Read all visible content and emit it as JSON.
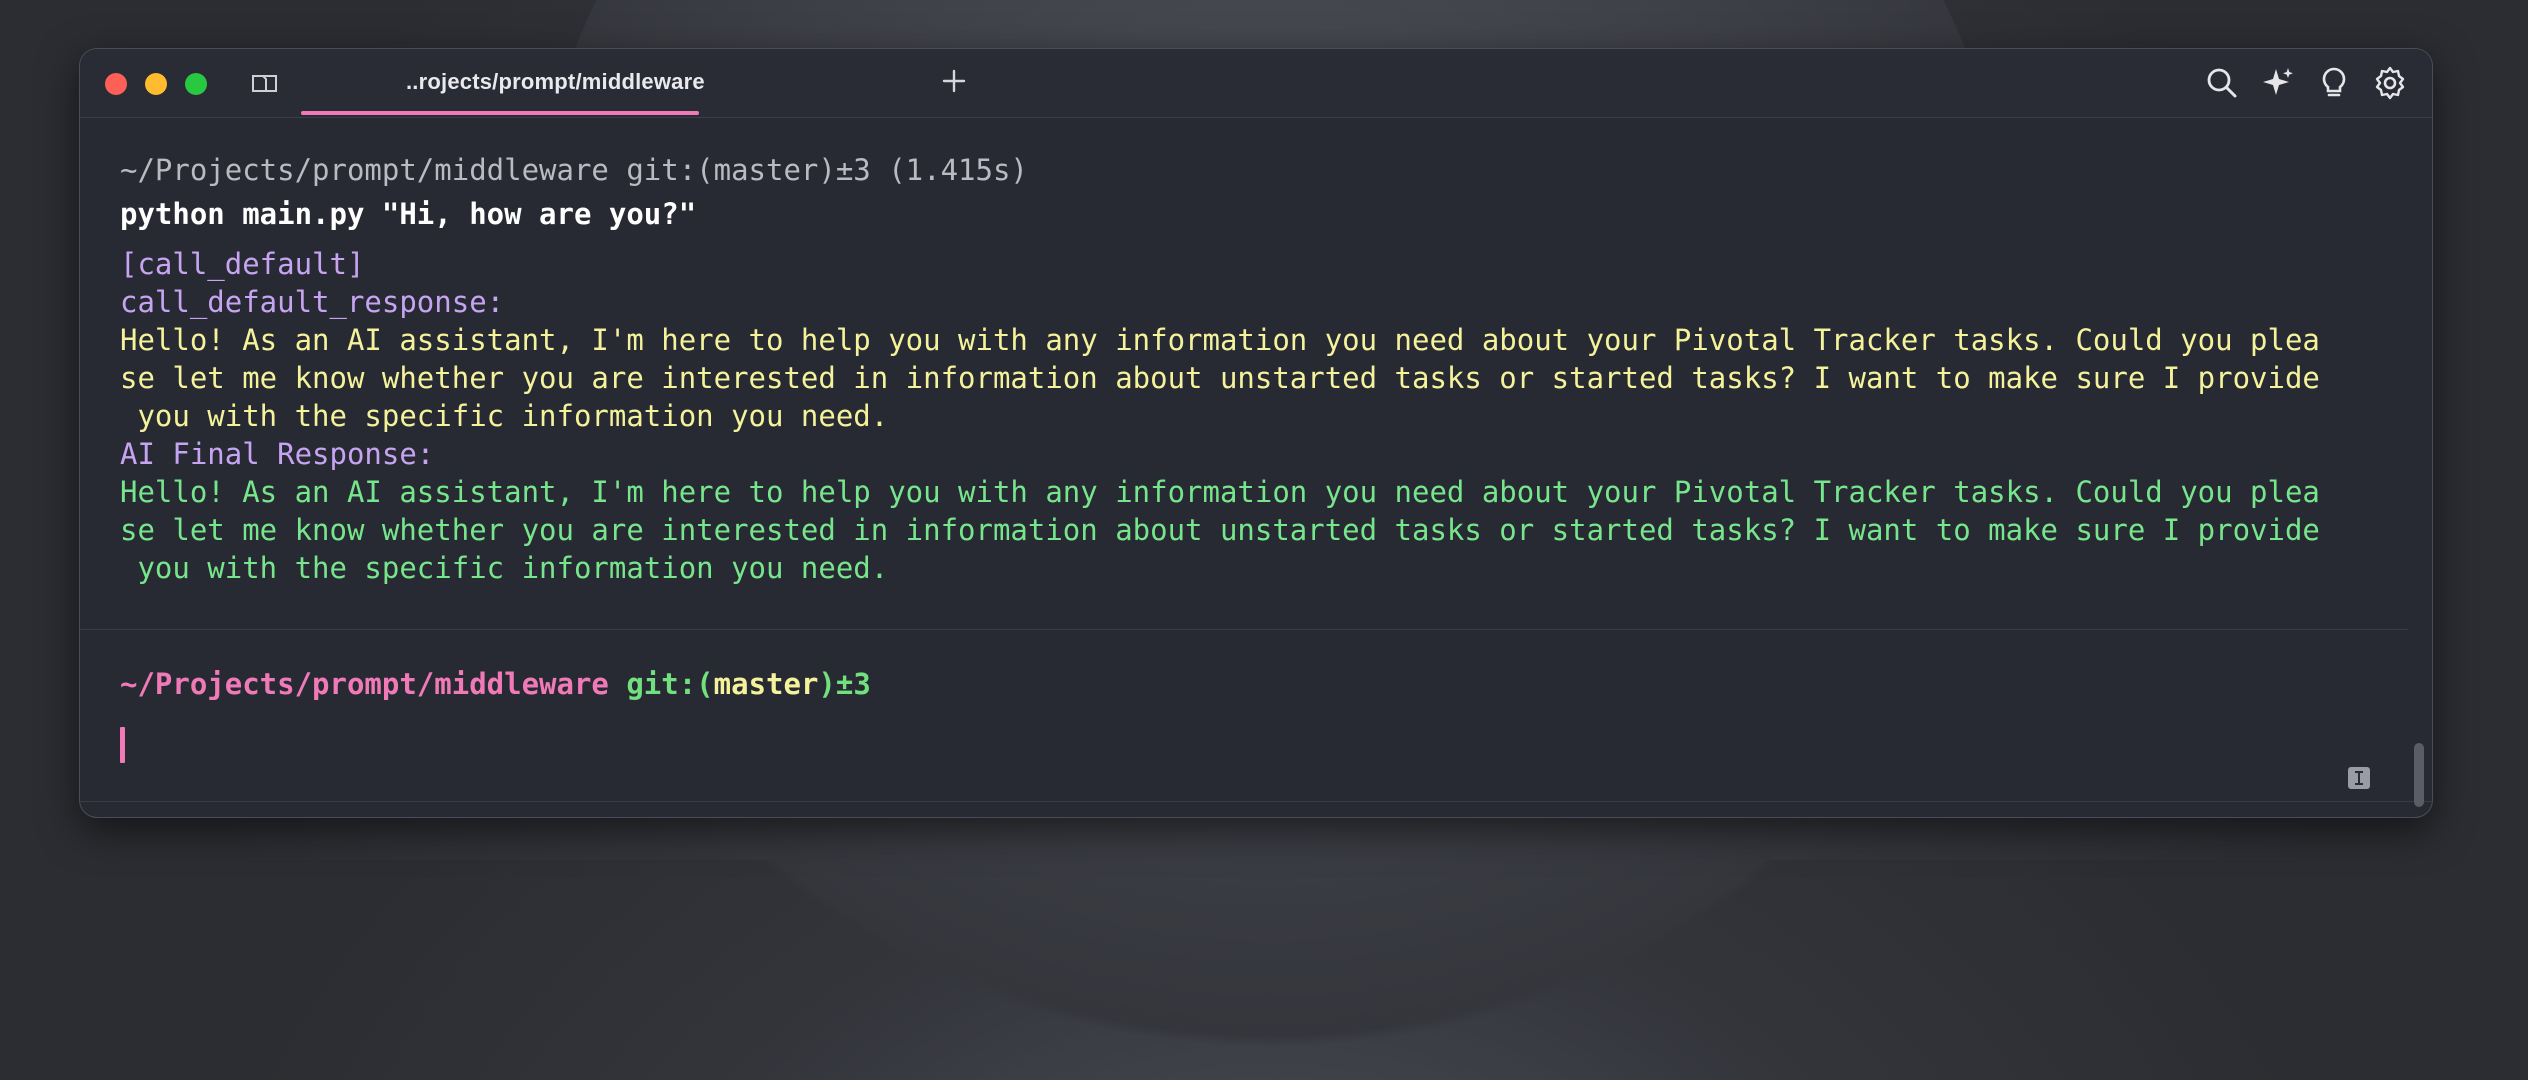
{
  "window": {
    "tab_title": "..rojects/prompt/middleware"
  },
  "icons": {
    "close": "close-button",
    "minimize": "minimize-button",
    "zoom": "zoom-button",
    "sidebar": "sidebar-toggle-icon",
    "new_tab": "plus-icon",
    "search": "search-icon",
    "ai": "sparkle-icon",
    "tips": "lightbulb-icon",
    "settings": "gear-icon",
    "text_mode": "ibeam-icon"
  },
  "colors": {
    "accent": "#f07ab8",
    "prompt_path": "#f07ab8",
    "git": "#72e07f",
    "branch": "#f4f29a",
    "label": "#c6a4f2",
    "default_response": "#f4f29a",
    "final_response": "#77e58c"
  },
  "block1": {
    "prompt_line": "~/Projects/prompt/middleware git:(master)±3 (1.415s)",
    "command": "python main.py \"Hi, how are you?\"",
    "output": [
      "[call_default]",
      "call_default_response:",
      "Hello! As an AI assistant, I'm here to help you with any information you need about your Pivotal Tracker tasks. Could you plea",
      "se let me know whether you are interested in information about unstarted tasks or started tasks? I want to make sure I provide",
      " you with the specific information you need.",
      "AI Final Response:",
      "Hello! As an AI assistant, I'm here to help you with any information you need about your Pivotal Tracker tasks. Could you plea",
      "se let me know whether you are interested in information about unstarted tasks or started tasks? I want to make sure I provide",
      " you with the specific information you need."
    ]
  },
  "prompt": {
    "path": "~/Projects/prompt/middleware",
    "git_prefix": "git:(",
    "branch": "master",
    "git_suffix": ")±3"
  }
}
